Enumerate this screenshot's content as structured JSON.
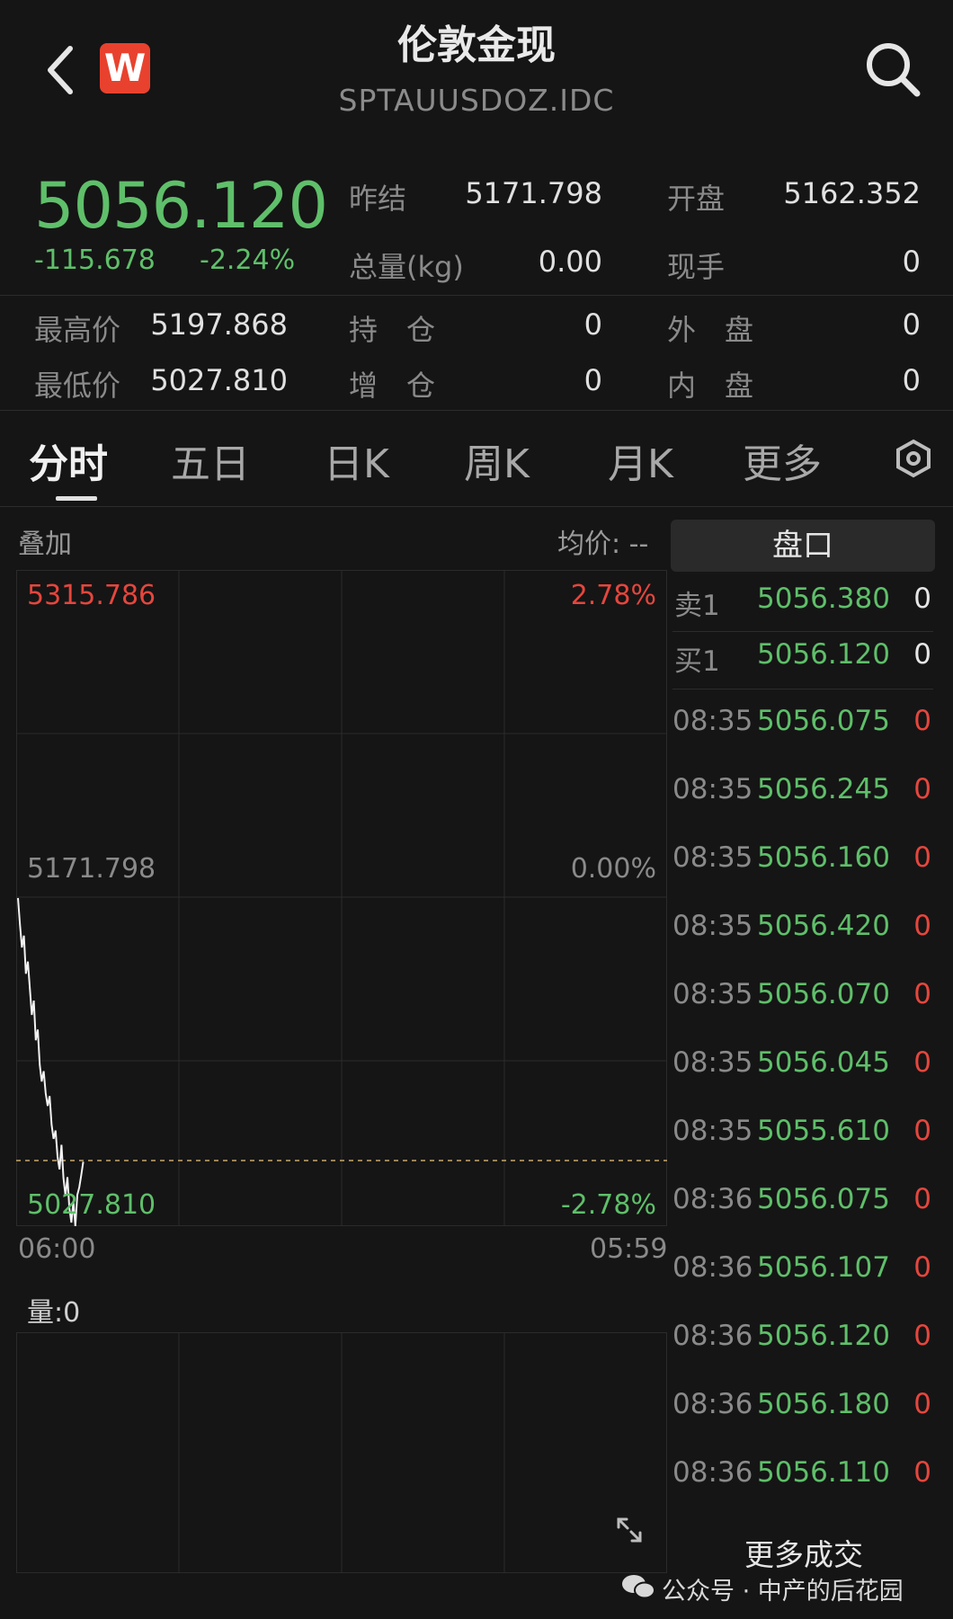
{
  "header": {
    "title": "伦敦金现",
    "subtitle": "SPTAUUSDOZ.IDC",
    "logo_letter": "W"
  },
  "quote": {
    "price": "5056.120",
    "change": "-115.678",
    "change_pct": "-2.24%",
    "fields": [
      {
        "label": "昨结",
        "value": "5171.798"
      },
      {
        "label": "开盘",
        "value": "5162.352"
      },
      {
        "label": "总量(kg)",
        "value": "0.00"
      },
      {
        "label": "现手",
        "value": "0"
      },
      {
        "label": "最高价",
        "value": "5197.868"
      },
      {
        "label": "持　仓",
        "value": "0"
      },
      {
        "label": "外　盘",
        "value": "0"
      },
      {
        "label": "最低价",
        "value": "5027.810"
      },
      {
        "label": "增　仓",
        "value": "0"
      },
      {
        "label": "内　盘",
        "value": "0"
      }
    ]
  },
  "tabs": [
    "分时",
    "五日",
    "日K",
    "周K",
    "月K",
    "更多"
  ],
  "chart": {
    "overlay_label": "叠加",
    "avg_label": "均价: --",
    "top_price": "5315.786",
    "top_pct": "2.78%",
    "mid_price": "5171.798",
    "mid_pct": "0.00%",
    "low_price": "5027.810",
    "low_pct": "-2.78%",
    "time_start": "06:00",
    "time_end": "05:59",
    "volume_label": "量:0"
  },
  "chart_data": {
    "type": "line",
    "series": [
      {
        "values": [
          5171.8,
          5160.2,
          5150.1,
          5155.3,
          5138.6,
          5143.9,
          5132.2,
          5120.5,
          5126.8,
          5109.4,
          5114.1,
          5098.7,
          5091.3,
          5095.8,
          5086.2,
          5080.6,
          5084.9,
          5072.3,
          5066.1,
          5069.8,
          5058.4,
          5052.7,
          5063.5,
          5048.9,
          5041.2,
          5049.3,
          5035.6,
          5029.4,
          5038.7,
          5027.8,
          5041.5,
          5044.9,
          5050.3,
          5056.1
        ]
      }
    ],
    "ylim": [
      5027.81,
      5315.786
    ],
    "reference": 5171.798
  },
  "orderbook": {
    "button": "盘口",
    "sell": {
      "label": "卖1",
      "price": "5056.380",
      "vol": "0"
    },
    "buy": {
      "label": "买1",
      "price": "5056.120",
      "vol": "0"
    }
  },
  "trades": [
    {
      "time": "08:35",
      "price": "5056.075",
      "vol": "0"
    },
    {
      "time": "08:35",
      "price": "5056.245",
      "vol": "0"
    },
    {
      "time": "08:35",
      "price": "5056.160",
      "vol": "0"
    },
    {
      "time": "08:35",
      "price": "5056.420",
      "vol": "0"
    },
    {
      "time": "08:35",
      "price": "5056.070",
      "vol": "0"
    },
    {
      "time": "08:35",
      "price": "5056.045",
      "vol": "0"
    },
    {
      "time": "08:35",
      "price": "5055.610",
      "vol": "0"
    },
    {
      "time": "08:36",
      "price": "5056.075",
      "vol": "0"
    },
    {
      "time": "08:36",
      "price": "5056.107",
      "vol": "0"
    },
    {
      "time": "08:36",
      "price": "5056.120",
      "vol": "0"
    },
    {
      "time": "08:36",
      "price": "5056.180",
      "vol": "0"
    },
    {
      "time": "08:36",
      "price": "5056.110",
      "vol": "0"
    }
  ],
  "more_trades": "更多成交",
  "watermark": "公众号 · 中产的后花园",
  "colors": {
    "up": "#e5463d",
    "down": "#5fbf6a",
    "bg": "#151515"
  }
}
